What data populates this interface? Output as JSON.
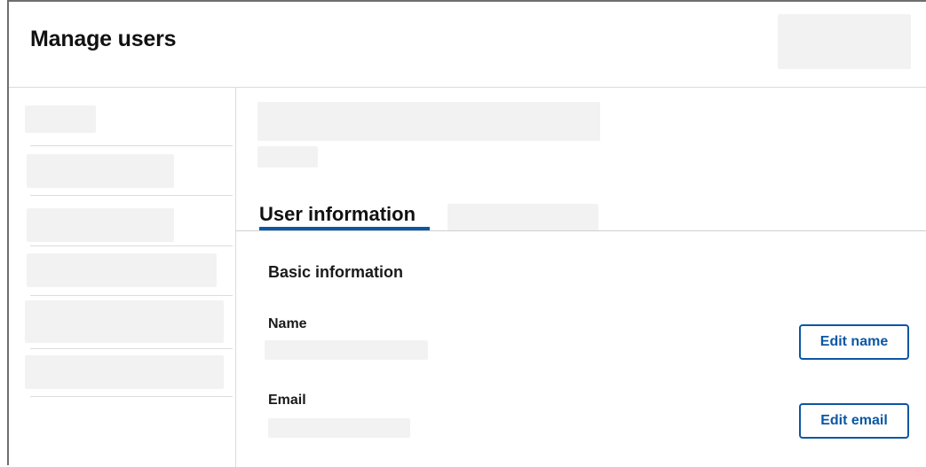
{
  "header": {
    "title": "Manage users"
  },
  "tabs": {
    "active_label": "User information"
  },
  "user_info": {
    "section_title": "Basic information",
    "name_label": "Name",
    "email_label": "Email",
    "edit_name_label": "Edit name",
    "edit_email_label": "Edit email"
  },
  "colors": {
    "accent": "#0b57a4",
    "placeholder": "#f2f2f2",
    "divider": "#dcdcdc"
  }
}
